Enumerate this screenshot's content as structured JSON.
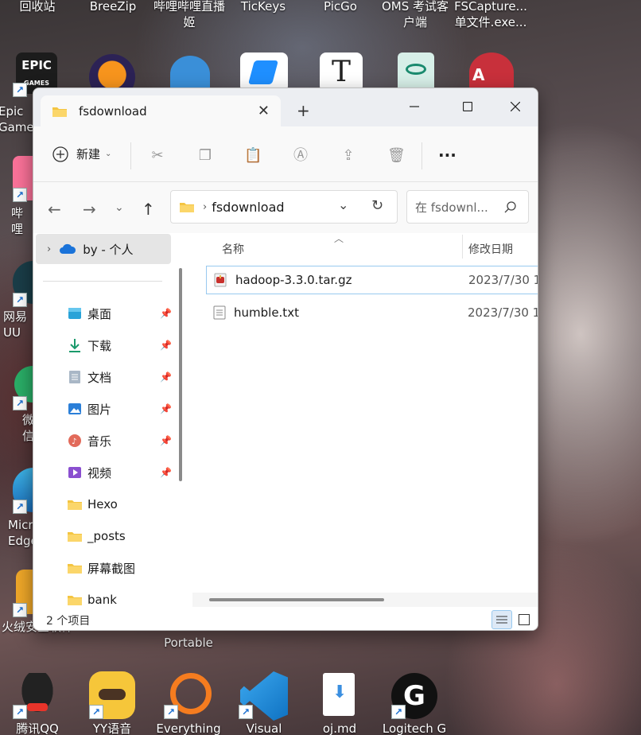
{
  "desktop": {
    "top_labels": [
      {
        "label": "回收站"
      },
      {
        "label": "BreeZip"
      },
      {
        "label": "哔哩哔哩直播姬"
      },
      {
        "label": "TicKeys"
      },
      {
        "label": "PicGo"
      },
      {
        "label": "OMS 考试客户端"
      },
      {
        "label": "FSCapture... 单文件.exe..."
      }
    ],
    "left_labels": [
      {
        "label": "Epic Games Launcher"
      },
      {
        "label": "哔哩"
      },
      {
        "label": "网易UU"
      },
      {
        "label": "微信"
      },
      {
        "label": "Microsoft Edge"
      },
      {
        "label": "火绒安全软件"
      }
    ],
    "bottom_labels": [
      {
        "label": "腾讯QQ"
      },
      {
        "label": "YY语音"
      },
      {
        "label": "Everything"
      },
      {
        "label": "Visual"
      },
      {
        "label": "oj.md"
      },
      {
        "label": "Logitech G"
      }
    ],
    "behind_window_label": "Portable"
  },
  "window": {
    "tab_title": "fsdownload",
    "new_tab_symbol": "+",
    "toolbar": {
      "new_label": "新建",
      "more_label": "..."
    },
    "address": {
      "path": "fsdownload"
    },
    "search": {
      "placeholder": "在 fsdownl..."
    },
    "sidebar": {
      "onedrive_label": "by - 个人",
      "items": [
        {
          "label": "桌面",
          "icon": "desktop-icon",
          "pinned": true
        },
        {
          "label": "下载",
          "icon": "download-icon",
          "pinned": true
        },
        {
          "label": "文档",
          "icon": "document-icon",
          "pinned": true
        },
        {
          "label": "图片",
          "icon": "pictures-icon",
          "pinned": true
        },
        {
          "label": "音乐",
          "icon": "music-icon",
          "pinned": true
        },
        {
          "label": "视频",
          "icon": "video-icon",
          "pinned": true
        },
        {
          "label": "Hexo",
          "icon": "folder-icon",
          "pinned": false
        },
        {
          "label": "_posts",
          "icon": "folder-icon",
          "pinned": false
        },
        {
          "label": "屏幕截图",
          "icon": "folder-icon",
          "pinned": false
        },
        {
          "label": "bank",
          "icon": "folder-icon",
          "pinned": false
        }
      ]
    },
    "columns": {
      "name": "名称",
      "modified": "修改日期"
    },
    "files": [
      {
        "name": "hadoop-3.3.0.tar.gz",
        "date": "2023/7/30 1",
        "icon": "archive-icon",
        "selected": true
      },
      {
        "name": "humble.txt",
        "date": "2023/7/30 1",
        "icon": "text-file-icon",
        "selected": false
      }
    ],
    "status": {
      "count_text": "2 个项目"
    }
  },
  "colors": {
    "accent": "#0067c0",
    "folder": "#f4c542",
    "selection_border": "#99c9ef"
  }
}
